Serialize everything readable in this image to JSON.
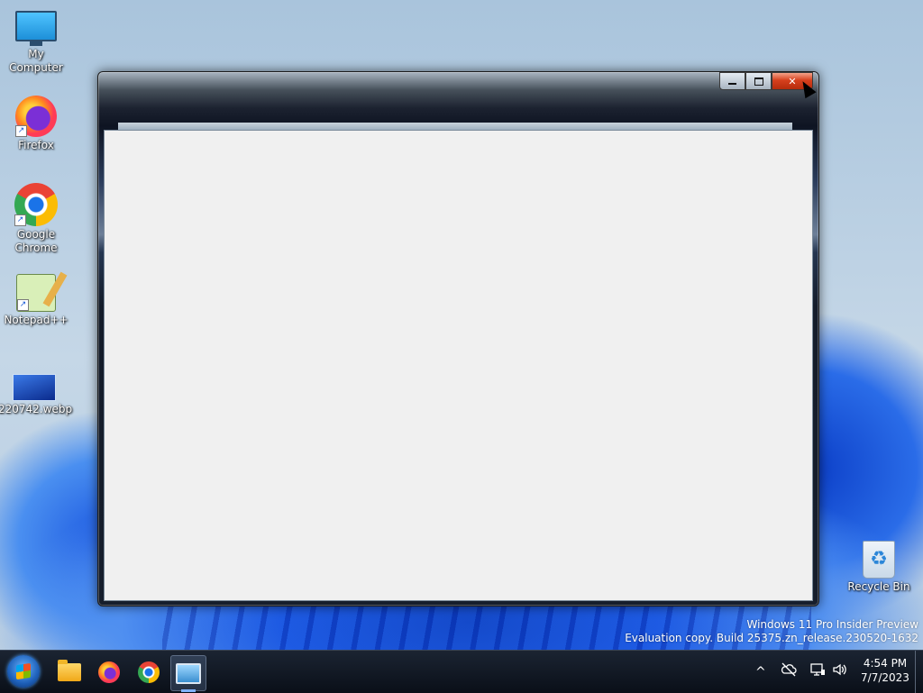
{
  "desktop": {
    "icons": [
      {
        "label": "My Computer",
        "icon": "computer-icon"
      },
      {
        "label": "Firefox",
        "icon": "firefox-icon"
      },
      {
        "label": "Google Chrome",
        "icon": "chrome-icon"
      },
      {
        "label": "Notepad++",
        "icon": "notepad-plus-plus-icon"
      },
      {
        "label": "220742.webp",
        "icon": "image-file-icon"
      },
      {
        "label": "Recycle Bin",
        "icon": "recycle-bin-icon"
      }
    ],
    "watermark": {
      "line1": "Windows 11 Pro Insider Preview",
      "line2": "Evaluation copy. Build 25375.zn_release.230520-1632"
    }
  },
  "window": {
    "title": "",
    "caption_buttons": {
      "minimize": "minimize",
      "maximize": "maximize",
      "close": "✕"
    }
  },
  "taskbar": {
    "apps": [
      {
        "name": "File Explorer",
        "icon": "folder-icon"
      },
      {
        "name": "Firefox",
        "icon": "firefox-icon"
      },
      {
        "name": "Google Chrome",
        "icon": "chrome-icon"
      },
      {
        "name": "Remote Desktop",
        "icon": "remote-desktop-icon",
        "active": true
      }
    ],
    "tray": {
      "chevron": "^",
      "clock_time": "4:54 PM",
      "clock_date": "7/7/2023"
    }
  },
  "colors": {
    "taskbar": "#0f1622",
    "client_area": "#f0f0f0",
    "close_button": "#d6401d",
    "accent": "#1552e0"
  }
}
